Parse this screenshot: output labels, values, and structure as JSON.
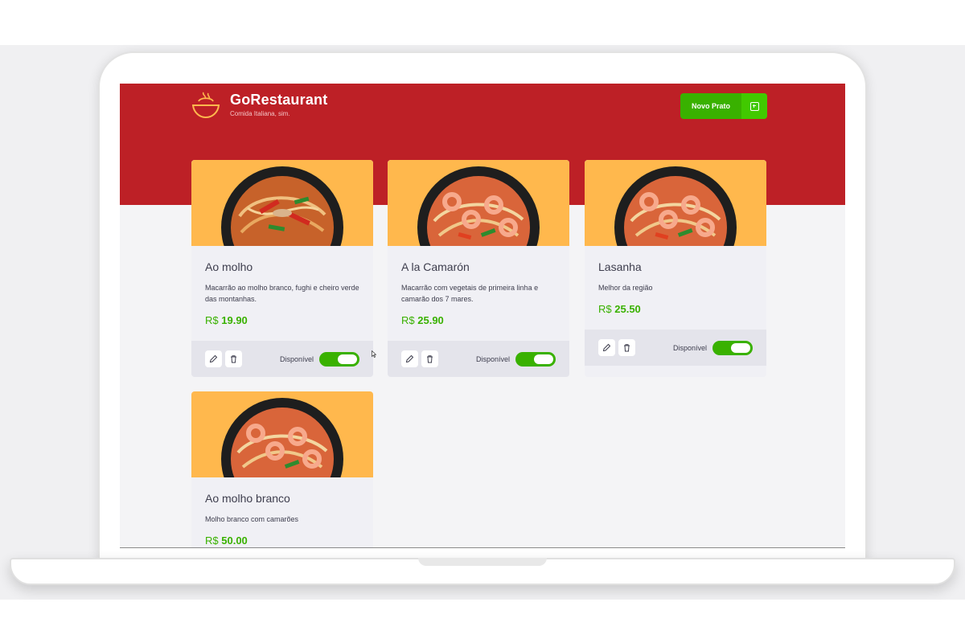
{
  "header": {
    "app_name": "GoRestaurant",
    "tagline": "Comida Italiana, sim.",
    "logo_icon": "bowl-icon",
    "new_dish_label": "Novo Prato",
    "new_dish_icon": "plus-square-icon"
  },
  "dishes": [
    {
      "name": "Ao molho",
      "description": "Macarrão ao molho branco, fughi e cheiro verde das montanhas.",
      "currency": "R$",
      "price": "19.90",
      "availability_label": "Disponível",
      "available": true
    },
    {
      "name": "A la Camarón",
      "description": "Macarrão com vegetais de primeira linha e camarão dos 7 mares.",
      "currency": "R$",
      "price": "25.90",
      "availability_label": "Disponível",
      "available": true
    },
    {
      "name": "Lasanha",
      "description": "Melhor da região",
      "currency": "R$",
      "price": "25.50",
      "availability_label": "Disponível",
      "available": true
    },
    {
      "name": "Ao molho branco",
      "description": "Molho branco com camarões",
      "currency": "R$",
      "price": "50.00"
    }
  ],
  "icons": {
    "edit": "pencil-icon",
    "delete": "trash-icon"
  },
  "colors": {
    "brand_red": "#bd2026",
    "accent_green": "#39b100",
    "image_background": "#ffb84d",
    "card_background": "#f0f0f5",
    "text_dark": "#3d3d4d"
  }
}
